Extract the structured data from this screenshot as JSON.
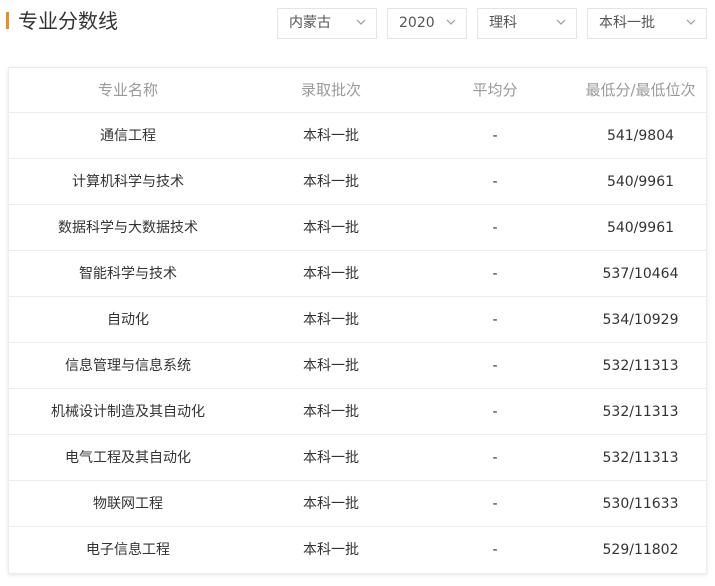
{
  "page": {
    "title": "专业分数线"
  },
  "filters": {
    "province": "内蒙古",
    "year": "2020",
    "subject": "理科",
    "batch": "本科一批"
  },
  "table": {
    "headers": [
      "专业名称",
      "录取批次",
      "平均分",
      "最低分/最低位次"
    ],
    "rows": [
      [
        "通信工程",
        "本科一批",
        "-",
        "541/9804"
      ],
      [
        "计算机科学与技术",
        "本科一批",
        "-",
        "540/9961"
      ],
      [
        "数据科学与大数据技术",
        "本科一批",
        "-",
        "540/9961"
      ],
      [
        "智能科学与技术",
        "本科一批",
        "-",
        "537/10464"
      ],
      [
        "自动化",
        "本科一批",
        "-",
        "534/10929"
      ],
      [
        "信息管理与信息系统",
        "本科一批",
        "-",
        "532/11313"
      ],
      [
        "机械设计制造及其自动化",
        "本科一批",
        "-",
        "532/11313"
      ],
      [
        "电气工程及其自动化",
        "本科一批",
        "-",
        "532/11313"
      ],
      [
        "物联网工程",
        "本科一批",
        "-",
        "530/11633"
      ],
      [
        "电子信息工程",
        "本科一批",
        "-",
        "529/11802"
      ]
    ]
  },
  "colors": {
    "accent": "#f08c28",
    "header_text": "#9a9a9a",
    "border": "#ececec"
  },
  "icons": {
    "dropdown": "chevron-down-icon"
  }
}
